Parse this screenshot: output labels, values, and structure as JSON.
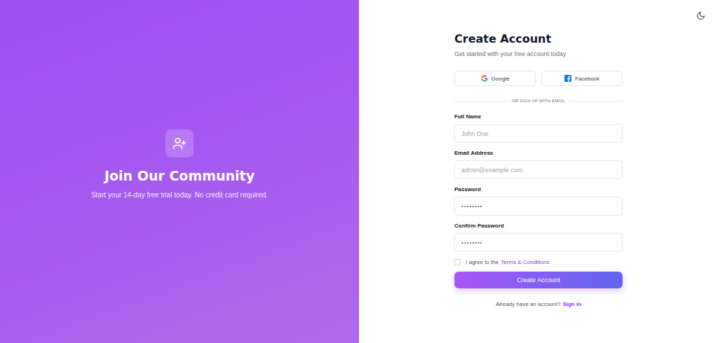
{
  "hero": {
    "title": "Join Our Community",
    "subtitle": "Start your 14-day free trial today. No credit card required."
  },
  "form": {
    "title": "Create Account",
    "subtitle": "Get started with your free account today"
  },
  "social_buttons": [
    {
      "label": "Google",
      "kind": "google"
    },
    {
      "label": "Facebook",
      "kind": "facebook"
    }
  ],
  "divider": "OR SIGN UP WITH EMAIL",
  "fields": [
    {
      "label": "Full Name",
      "text": "John Doe",
      "kind": "placeholder"
    },
    {
      "label": "Email Address",
      "text": "admin@example.com",
      "kind": "placeholder"
    },
    {
      "label": "Password",
      "text": "••••••••",
      "kind": "masked"
    },
    {
      "label": "Confirm Password",
      "text": "••••••••",
      "kind": "masked"
    }
  ],
  "terms": {
    "prefix": "I agree to the",
    "link": "Terms & Conditions",
    "checked": false
  },
  "submit": "Create Account",
  "footer": {
    "prefix": "Already have an account?",
    "link": "Sign in"
  }
}
